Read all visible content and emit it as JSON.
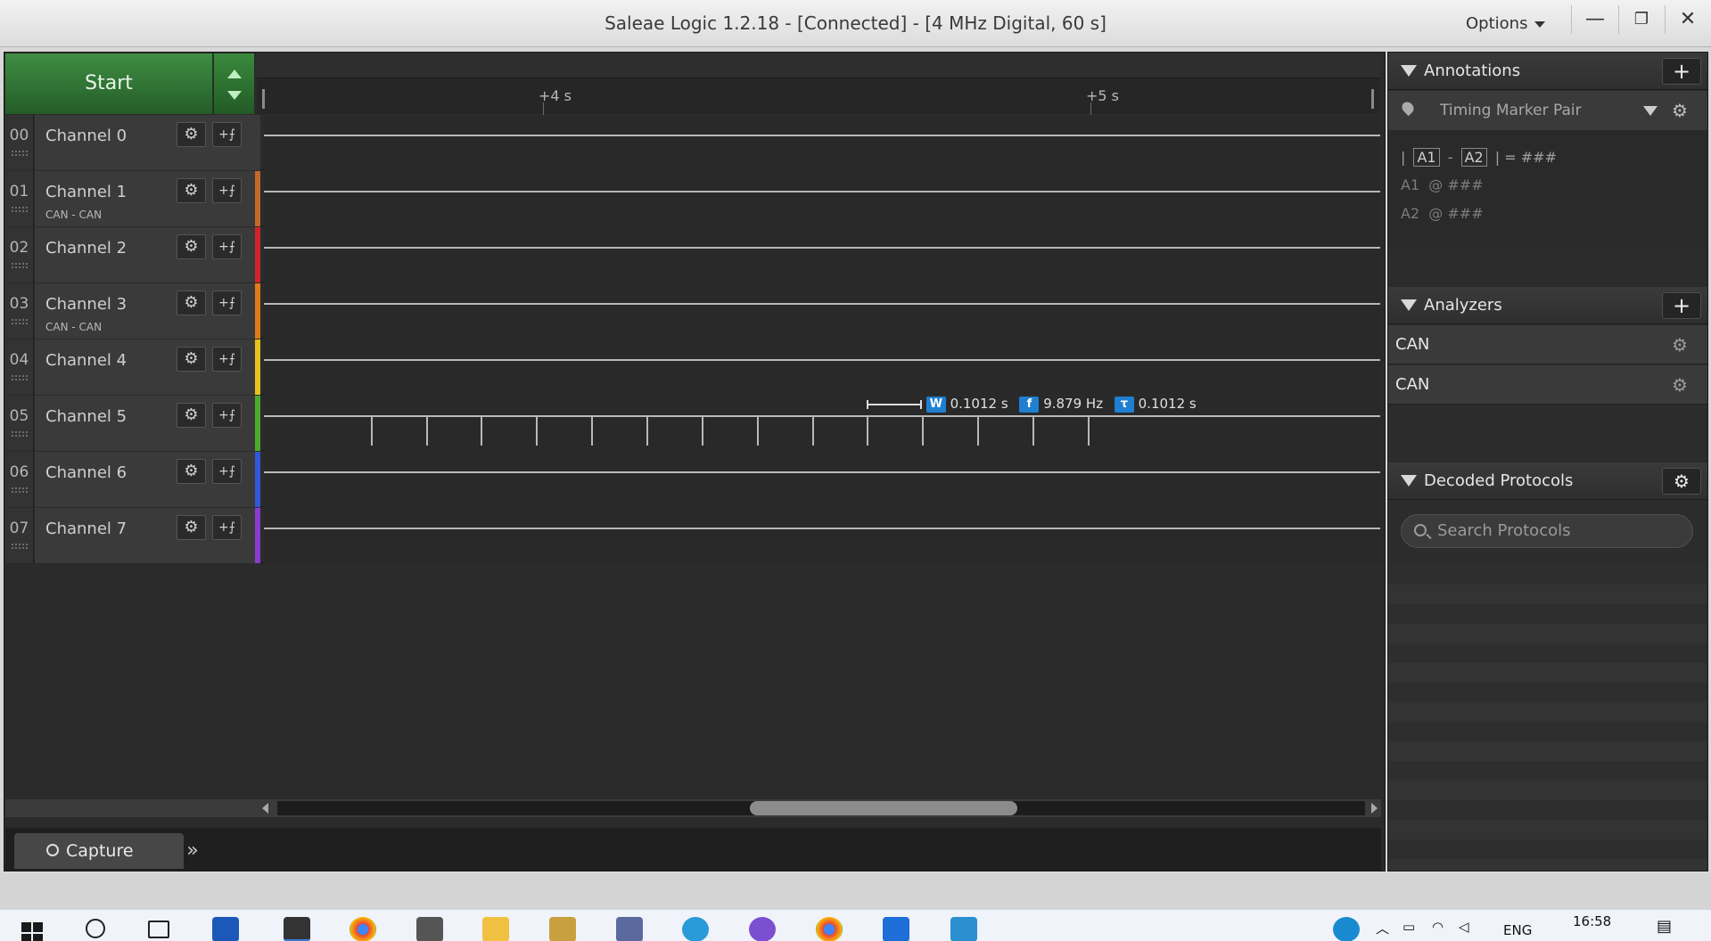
{
  "window": {
    "title": "Saleae Logic 1.2.18 - [Connected] - [4 MHz Digital, 60 s]",
    "options_label": "Options",
    "minimize": "—",
    "restore": "❐",
    "close": "✕"
  },
  "capture": {
    "start_label": "Start"
  },
  "timeline": {
    "ticks": [
      "+4 s",
      "+5 s"
    ]
  },
  "channels": [
    {
      "num": "00",
      "name": "Channel 0",
      "sub": "",
      "color": "#3a3a3a"
    },
    {
      "num": "01",
      "name": "Channel 1",
      "sub": "CAN - CAN",
      "color": "#c0692a"
    },
    {
      "num": "02",
      "name": "Channel 2",
      "sub": "",
      "color": "#d0242a"
    },
    {
      "num": "03",
      "name": "Channel 3",
      "sub": "CAN - CAN",
      "color": "#e07a1a"
    },
    {
      "num": "04",
      "name": "Channel 4",
      "sub": "",
      "color": "#e6c21a"
    },
    {
      "num": "05",
      "name": "Channel 5",
      "sub": "",
      "color": "#4caa2c"
    },
    {
      "num": "06",
      "name": "Channel 6",
      "sub": "",
      "color": "#3258d8"
    },
    {
      "num": "07",
      "name": "Channel 7",
      "sub": "",
      "color": "#8a3ad0"
    }
  ],
  "measurement": {
    "width_badge": "W",
    "width_value": "0.1012 s",
    "freq_badge": "f",
    "freq_value": "9.879 Hz",
    "period_badge": "τ",
    "period_value": "0.1012 s"
  },
  "bottom": {
    "capture_tab": "Capture",
    "expand": "»"
  },
  "annotations": {
    "header": "Annotations",
    "add": "+",
    "marker_pair": "Timing Marker Pair",
    "pair_line": {
      "a1": "A1",
      "dash": "-",
      "a2": "A2",
      "eq": "| = ###",
      "open": "|"
    },
    "a1_label": "A1",
    "a1_value": "@  ###",
    "a2_label": "A2",
    "a2_value": "@  ###"
  },
  "analyzers": {
    "header": "Analyzers",
    "add": "+",
    "items": [
      "CAN",
      "CAN"
    ]
  },
  "decoded": {
    "header": "Decoded Protocols",
    "search_placeholder": "Search Protocols"
  },
  "taskbar": {
    "lang": "ENG",
    "time": "16:58"
  }
}
